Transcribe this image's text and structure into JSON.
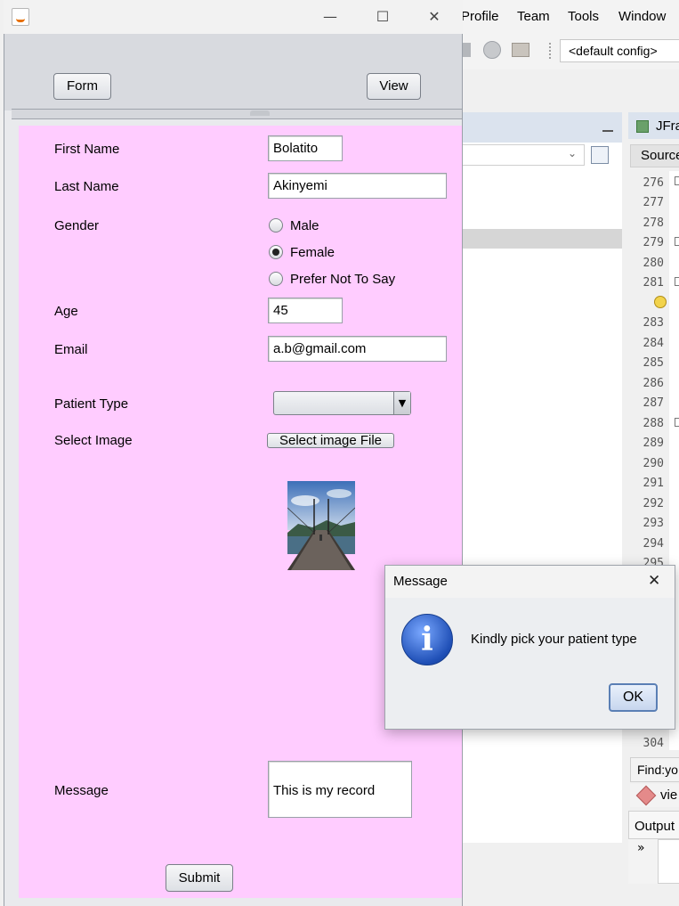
{
  "ide": {
    "menu": [
      "Profile",
      "Team",
      "Tools",
      "Window"
    ],
    "config": "<default config>",
    "right_tab": "JFra",
    "source_tab": "Source",
    "line_numbers": [
      "276",
      "277",
      "278",
      "279",
      "280",
      "281",
      "",
      "283",
      "284",
      "285",
      "286",
      "287",
      "288",
      "289",
      "290",
      "291",
      "292",
      "293",
      "294",
      "295",
      "304"
    ],
    "find_label": "Find:",
    "find_value": "yo",
    "view_item": "vie",
    "output_tab": "Output",
    "output_gutter": "»"
  },
  "window": {
    "minimize": "—",
    "maximize": "☐",
    "close": "✕"
  },
  "toolbar": {
    "form_button": "Form",
    "view_button": "View"
  },
  "form": {
    "first_name_label": "First Name",
    "first_name_value": "Bolatito",
    "last_name_label": "Last Name",
    "last_name_value": "Akinyemi",
    "gender_label": "Gender",
    "gender_options": [
      "Male",
      "Female",
      "Prefer Not To Say"
    ],
    "gender_selected": "Female",
    "age_label": "Age",
    "age_value": "45",
    "email_label": "Email",
    "email_value": "a.b@gmail.com",
    "patient_type_label": "Patient Type",
    "patient_type_value": "",
    "select_image_label": "Select Image",
    "select_image_button": "Select image File",
    "message_label": "Message",
    "message_value": "This is my record",
    "submit_button": "Submit"
  },
  "dialog": {
    "title": "Message",
    "close": "✕",
    "icon": "info-icon",
    "text": "Kindly pick your patient type",
    "ok_button": "OK"
  }
}
